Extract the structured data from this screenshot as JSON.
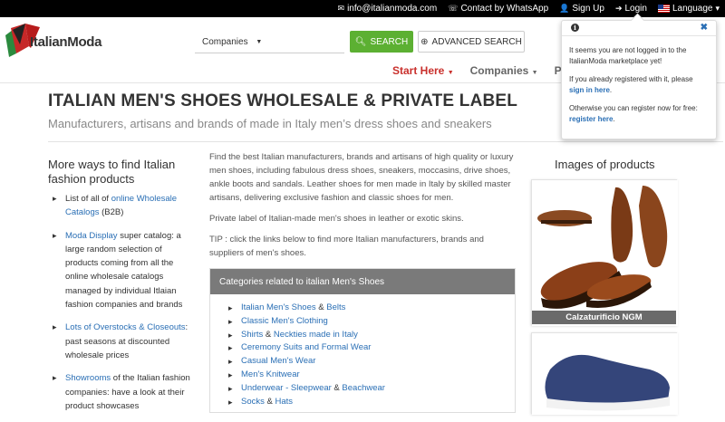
{
  "topbar": {
    "email": "info@italianmoda.com",
    "whatsapp": "Contact by WhatsApp",
    "signup": "Sign Up",
    "login": "Login",
    "language": "Language"
  },
  "header": {
    "logo_text": "ItalianModa",
    "search_select": "Companies",
    "search_button": "SEARCH",
    "advanced_button": "ADVANCED SEARCH",
    "nav": {
      "start": "Start Here",
      "companies": "Companies",
      "products": "Prod"
    }
  },
  "page": {
    "title": "ITALIAN MEN'S SHOES WHOLESALE & PRIVATE LABEL",
    "subtitle": "Manufacturers, artisans and brands of made in Italy men’s dress shoes and sneakers"
  },
  "left": {
    "heading": "More ways to find Italian fashion products",
    "items": [
      {
        "pre": "List of all of ",
        "link": "online Wholesale Catalogs",
        "post": " (B2B)"
      },
      {
        "pre": "",
        "link": "Moda Display",
        "post": " super catalog: a large random selection of products coming from all the online wholesale catalogs managed by individual Itlaian fashion companies and brands"
      },
      {
        "pre": "",
        "link": "Lots of Overstocks & Closeouts",
        "post": ": past seasons at discounted wholesale prices"
      },
      {
        "pre": "",
        "link": "Showrooms",
        "post": " of the Italian fashion companies: have a look at their product showcases"
      }
    ]
  },
  "middle": {
    "p1": "Find the best Italian manufacturers, brands and artisans of high quality or luxury men shoes, including fabulous dress shoes, sneakers, moccasins, drive shoes, ankle boots and sandals. Leather shoes for men made in Italy by skilled master artisans, delivering exclusive fashion and classic shoes for men.",
    "p2": "Private label of Italian-made men's shoes in leather or exotic skins.",
    "p3": "TIP : click the links below to find more Italian manufacturers, brands and suppliers of men's shoes.",
    "categories_heading": "Categories related to italian Men's Shoes",
    "categories": [
      {
        "a": "Italian Men's Shoes",
        "sep": " & ",
        "b": "Belts"
      },
      {
        "a": "Classic Men's Clothing",
        "sep": "",
        "b": ""
      },
      {
        "a": "Shirts",
        "sep": " & ",
        "b": "Neckties made in Italy"
      },
      {
        "a": "Ceremony Suits and Formal Wear",
        "sep": "",
        "b": ""
      },
      {
        "a": "Casual Men's Wear",
        "sep": "",
        "b": ""
      },
      {
        "a": "Men's Knitwear",
        "sep": "",
        "b": ""
      },
      {
        "a": "Underwear - Sleepwear",
        "sep": " & ",
        "b": "Beachwear"
      },
      {
        "a": "Socks",
        "sep": " & ",
        "b": "Hats"
      }
    ]
  },
  "right": {
    "heading": "Images of products",
    "card1_caption": "Calzaturificio NGM"
  },
  "popup": {
    "line1": "It seems you are not logged in to the ItalianModa marketplace yet!",
    "line2_pre": "If you already registered with it, please ",
    "line2_link": "sign in here",
    "line2_post": ".",
    "line3_pre": "Otherwise you can register now for free: ",
    "line3_link": "register here",
    "line3_post": "."
  }
}
